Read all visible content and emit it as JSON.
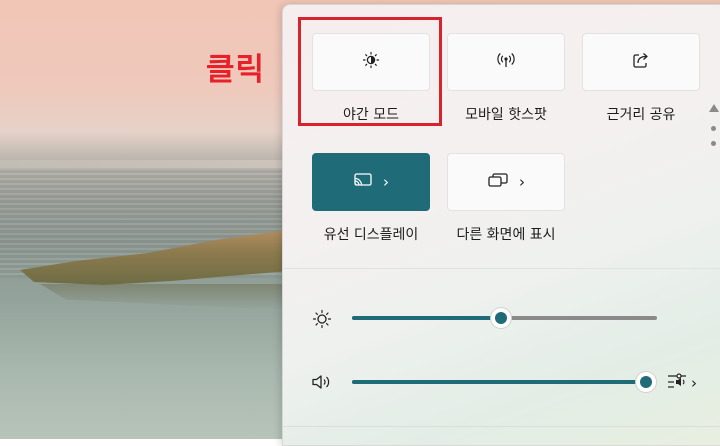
{
  "annotation": {
    "text": "클릭"
  },
  "tiles": [
    {
      "label": "야간 모드",
      "icon": "night-light-icon",
      "active": false
    },
    {
      "label": "모바일 핫스팟",
      "icon": "mobile-hotspot-icon",
      "active": false
    },
    {
      "label": "근거리 공유",
      "icon": "nearby-share-icon",
      "active": false
    },
    {
      "label": "유선 디스플레이",
      "icon": "cast-icon",
      "active": true,
      "has_chevron": true
    },
    {
      "label": "다른 화면에 표시",
      "icon": "project-icon",
      "active": false,
      "has_chevron": true
    }
  ],
  "sliders": {
    "brightness": {
      "icon": "brightness-icon",
      "value_percent": 49
    },
    "volume": {
      "icon": "speaker-icon",
      "value_percent": 100
    }
  },
  "audio_mixer": {
    "icon": "audio-mixer-icon"
  },
  "colors": {
    "accent": "#1f6b78",
    "highlight": "#d9232b",
    "annotation": "#e8202a"
  }
}
